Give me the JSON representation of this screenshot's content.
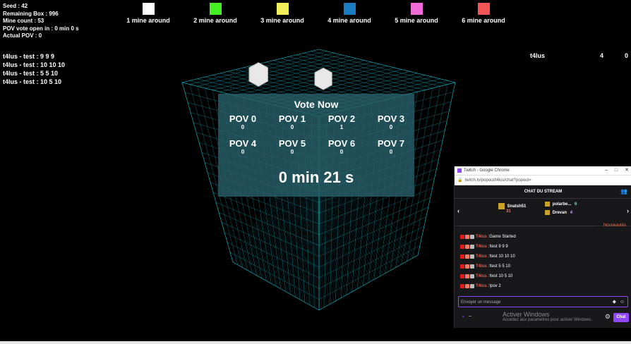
{
  "hud": {
    "seed": "Seed : 42",
    "remaining": "Remaining Box : 996",
    "mines": "Mine count : 53",
    "pov_open": "POV vote open in :  0 min 0 s",
    "actual_pov": "Actual POV : 0"
  },
  "legend": [
    {
      "label": "1 mine around",
      "color": "#ffffff"
    },
    {
      "label": "2 mine around",
      "color": "#44ee22"
    },
    {
      "label": "3 mine around",
      "color": "#f2f05a"
    },
    {
      "label": "4 mine around",
      "color": "#1a7cc2"
    },
    {
      "label": "5 mine around",
      "color": "#f06ad8"
    },
    {
      "label": "6 mine around",
      "color": "#f25555"
    }
  ],
  "log": [
    "t4lus - test : 9 9 9",
    "t4lus - test : 10 10 10",
    "t4lus - test : 5 5 10",
    "t4lus - test : 10 5 10"
  ],
  "scoreboard": {
    "name": "t4lus",
    "score": "4",
    "fails": "0"
  },
  "vote": {
    "title": "Vote Now",
    "povs": [
      {
        "label": "POV 0",
        "count": "0"
      },
      {
        "label": "POV 1",
        "count": "0"
      },
      {
        "label": "POV 2",
        "count": "1"
      },
      {
        "label": "POV 3",
        "count": "0"
      },
      {
        "label": "POV 4",
        "count": "0"
      },
      {
        "label": "POV 5",
        "count": "0"
      },
      {
        "label": "POV 6",
        "count": "0"
      },
      {
        "label": "POV 7",
        "count": "0"
      }
    ],
    "timer": "0 min 21 s"
  },
  "chat_window": {
    "title": "Twitch - Google Chrome",
    "url": "twitch.tv/popout/t4lus/chat?popout=",
    "header": "CHAT DU STREAM",
    "leaders": [
      {
        "name": "Snatsh51",
        "value": "31"
      },
      {
        "name": "polarbe...",
        "value": "6"
      },
      {
        "name": "Drevan",
        "value": "4"
      }
    ],
    "new_label": "Nouveautés",
    "messages": [
      {
        "user": "T4lus",
        "text": "Game Started"
      },
      {
        "user": "T4lus",
        "text": "!test 9 9 9"
      },
      {
        "user": "T4lus",
        "text": "!test 10 10 10"
      },
      {
        "user": "T4lus",
        "text": "!test 5 5 10"
      },
      {
        "user": "T4lus",
        "text": "!test 10 5 10"
      },
      {
        "user": "T4lus",
        "text": "!pov 2"
      }
    ],
    "input_placeholder": "Envoyer un message",
    "points": "--",
    "chat_button": "Chat",
    "activate_title": "Activer Windows",
    "activate_sub": "Accédez aux paramètres pour activer Windows."
  },
  "colors": {
    "cube_line": "#17b8c8",
    "overlay": "#285f69",
    "twitch": "#9146ff"
  }
}
